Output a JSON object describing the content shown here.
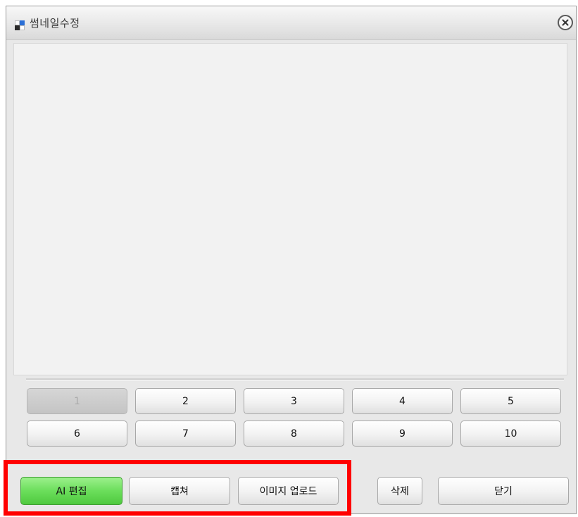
{
  "window": {
    "title": "썸네일수정"
  },
  "icons": {
    "title_icon": "app-window-icon",
    "close_icon": "close-circle-icon"
  },
  "pages": {
    "row1": [
      "1",
      "2",
      "3",
      "4",
      "5"
    ],
    "row2": [
      "6",
      "7",
      "8",
      "9",
      "10"
    ],
    "selected": "1"
  },
  "actions": {
    "ai_edit": "AI 편집",
    "capture": "캡쳐",
    "image_upload": "이미지 업로드",
    "delete": "삭제",
    "close": "닫기"
  },
  "colors": {
    "highlight": "#ff0000",
    "ai_edit_button": "#6bde5b"
  }
}
